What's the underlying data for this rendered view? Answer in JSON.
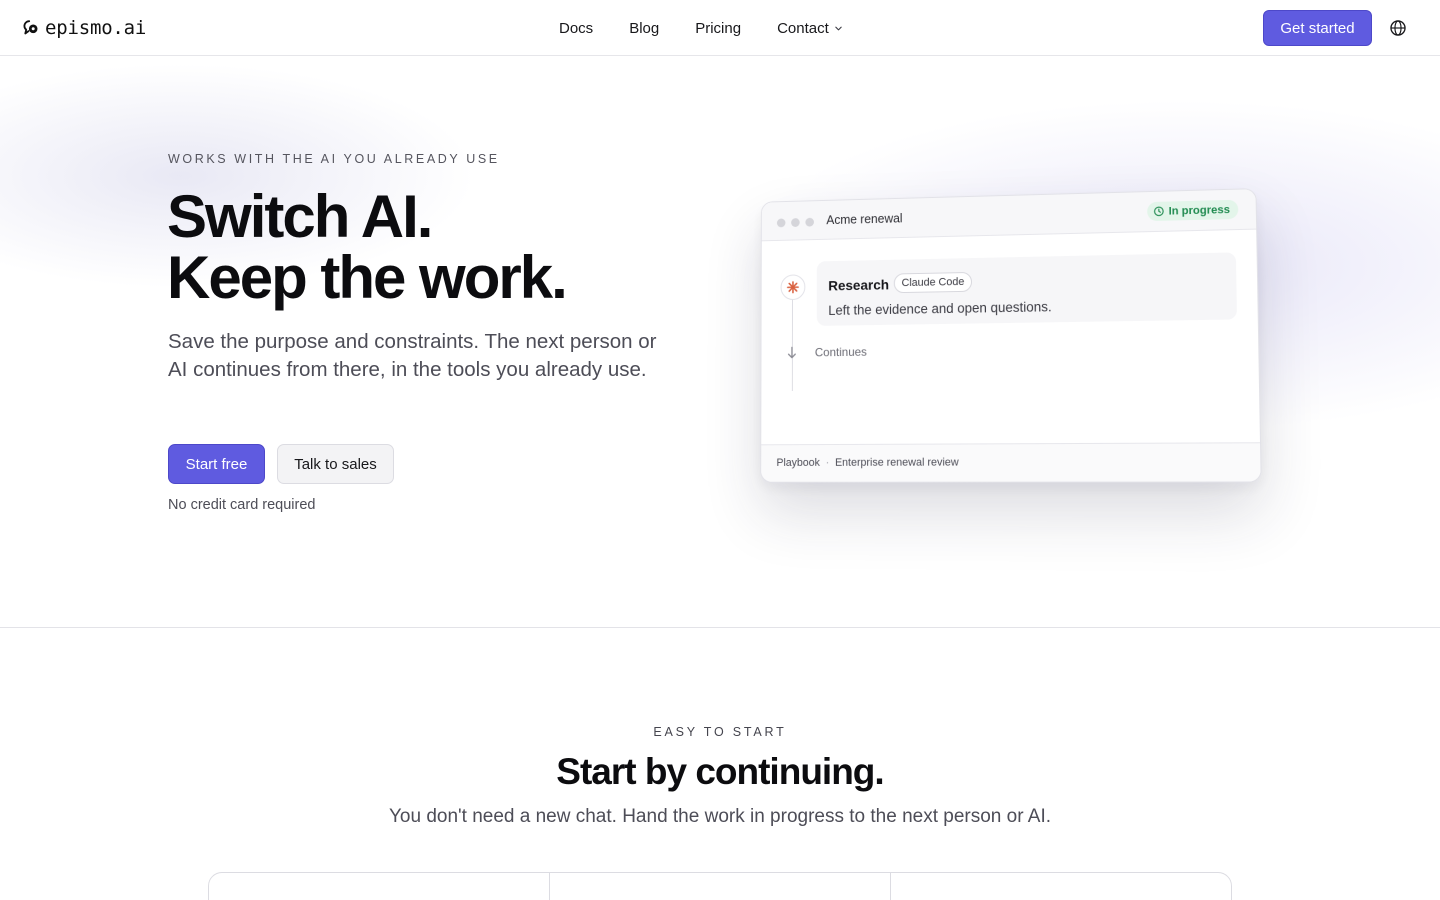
{
  "header": {
    "brand": "epismo.ai",
    "nav": [
      "Docs",
      "Blog",
      "Pricing",
      "Contact"
    ],
    "cta": "Get started"
  },
  "hero": {
    "eyebrow": "WORKS WITH THE AI YOU ALREADY USE",
    "headline_line1": "Switch AI.",
    "headline_line2": "Keep the work.",
    "lede": "Save the purpose and constraints. The next person or AI continues from there, in the tools you already use.",
    "primary_cta": "Start free",
    "secondary_cta": "Talk to sales",
    "note": "No credit card required"
  },
  "preview": {
    "title": "Acme renewal",
    "status": "In progress",
    "step_title": "Research",
    "step_tool": "Claude Code",
    "step_desc": "Left the evidence and open questions.",
    "continues": "Continues",
    "footer_label": "Playbook",
    "footer_sep": "·",
    "footer_value": "Enterprise renewal review"
  },
  "section": {
    "eyebrow": "EASY TO START",
    "title": "Start by continuing.",
    "subtitle": "You don't need a new chat. Hand the work in progress to the next person or AI."
  },
  "colors": {
    "accent": "#5f5be0",
    "status_bg": "#e3f5ea",
    "status_text": "#1f8a4f",
    "claude_mark": "#d9603f"
  },
  "icons": {
    "brand": "epismo-logo-icon",
    "dropdown": "chevron-down-icon",
    "language": "globe-icon",
    "status": "clock-icon",
    "step": "claude-sparkle-icon",
    "flow": "arrow-down-icon"
  }
}
